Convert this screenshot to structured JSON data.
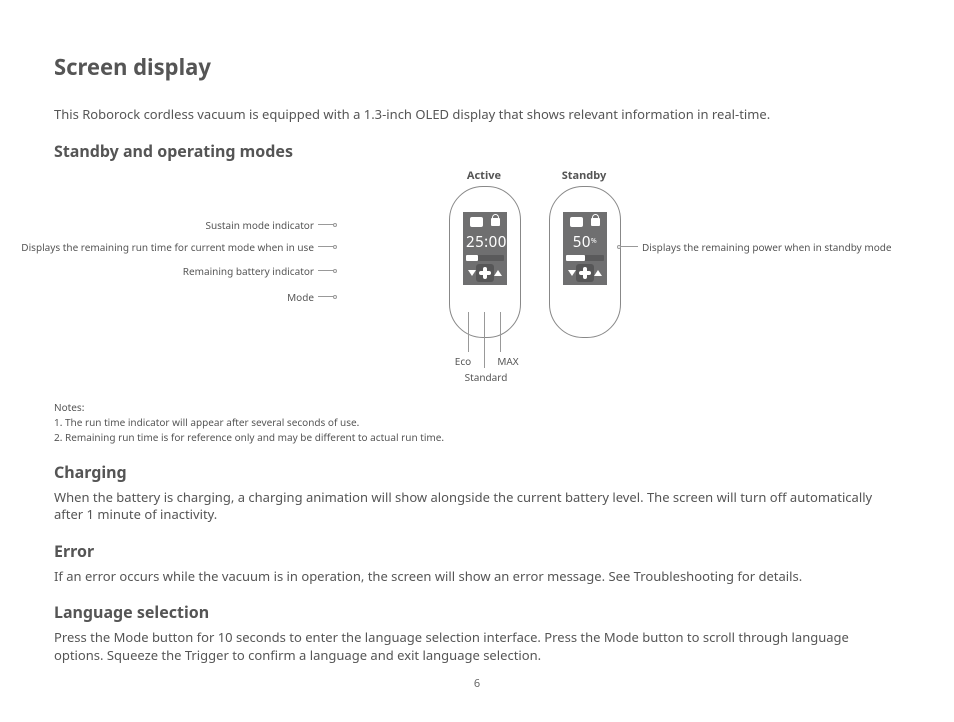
{
  "heading": "Screen display",
  "intro": "This Roborock cordless vacuum is equipped with a 1.3-inch OLED display that shows relevant information in real-time.",
  "section_modes": "Standby and operating modes",
  "fig": {
    "active_title": "Active",
    "standby_title": "Standby",
    "active_value": "25:00",
    "standby_value": "50",
    "standby_unit": "%",
    "lbl_sustain": "Sustain mode indicator",
    "lbl_runtime": "Displays the remaining run time for current mode when in use",
    "lbl_battery": "Remaining battery indicator",
    "lbl_mode": "Mode",
    "lbl_power": "Displays the remaining power when in standby mode",
    "eco": "Eco",
    "max": "MAX",
    "standard": "Standard"
  },
  "notes_title": "Notes:",
  "note1": "1. The run time indicator will appear after several seconds of use.",
  "note2": "2. Remaining run time is for reference only and may be different to actual run time.",
  "section_charge": "Charging",
  "charging_body": "When the battery is charging, a charging animation will show alongside the current battery level. The screen will turn off automatically after 1 minute of inactivity.",
  "section_error": "Error",
  "error_body": "If an error occurs while the vacuum is in operation, the screen will show an error message. See Troubleshooting for details.",
  "section_lang": "Language selection",
  "lang_body": "Press the Mode button for 10 seconds to enter the language selection interface. Press the Mode button to scroll through language options. Squeeze the Trigger to confirm a language and exit language selection.",
  "page_number": "6"
}
